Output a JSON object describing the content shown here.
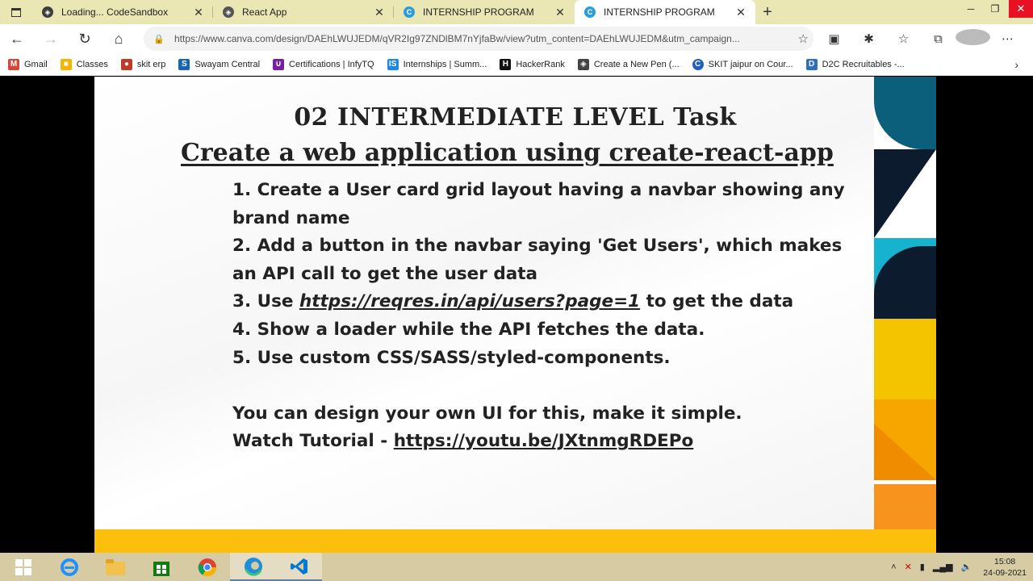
{
  "browser": {
    "tabs": [
      {
        "title": "Loading... CodeSandbox",
        "favicon": "codesandbox-icon",
        "active": false
      },
      {
        "title": "React App",
        "favicon": "react-icon",
        "active": false
      },
      {
        "title": "INTERNSHIP PROGRAM",
        "favicon": "canva-icon",
        "active": false
      },
      {
        "title": "INTERNSHIP PROGRAM",
        "favicon": "canva-icon",
        "active": true
      }
    ],
    "url": "https://www.canva.com/design/DAEhLWUJEDM/qVR2Ig97ZNDlBM7nYjfaBw/view?utm_content=DAEhLWUJEDM&utm_campaign...",
    "bookmarks": [
      {
        "label": "Gmail",
        "color": "#d44638",
        "glyph": "M"
      },
      {
        "label": "Classes",
        "color": "#f4b400",
        "glyph": "■"
      },
      {
        "label": "skit erp",
        "color": "#c0392b",
        "glyph": "●"
      },
      {
        "label": "Swayam Central",
        "color": "#1565c0",
        "glyph": "S"
      },
      {
        "label": "Certifications | InfyTQ",
        "color": "#7b1fa2",
        "glyph": "∪"
      },
      {
        "label": "Internships | Summ...",
        "color": "#1e88e5",
        "glyph": "IS"
      },
      {
        "label": "HackerRank",
        "color": "#111111",
        "glyph": "H"
      },
      {
        "label": "Create a New Pen (...",
        "color": "#444444",
        "glyph": "◈"
      },
      {
        "label": "SKIT jaipur on Cour...",
        "color": "#1f5fbf",
        "glyph": "C"
      },
      {
        "label": "D2C Recruitables -...",
        "color": "#2c6fbb",
        "glyph": "D"
      }
    ]
  },
  "slide": {
    "heading": "02 INTERMEDIATE LEVEL Task",
    "subheading": " Create a web application using create-react-app",
    "items": [
      {
        "line1": "1. Create a User card grid layout having a navbar showing any",
        "line2": "brand name"
      },
      {
        "line1": "2. Add a button in the navbar saying 'Get Users', which makes",
        "line2": "an API call to get the user data"
      },
      {
        "prefix": "3. Use ",
        "link": "https://reqres.in/api/users?page=1",
        "suffix": " to get the data"
      },
      {
        "line1": "4. Show a loader while the API fetches the data."
      },
      {
        "line1": "5. Use custom CSS/SASS/styled-components."
      }
    ],
    "note": "You can design your own UI for this, make it simple.",
    "tutorial_prefix": "Watch Tutorial - ",
    "tutorial_link": "https://youtu.be/JXtnmgRDEPo",
    "accent_color": "#fbbf0c"
  },
  "taskbar": {
    "time": "15:08",
    "date": "24-09-2021"
  }
}
